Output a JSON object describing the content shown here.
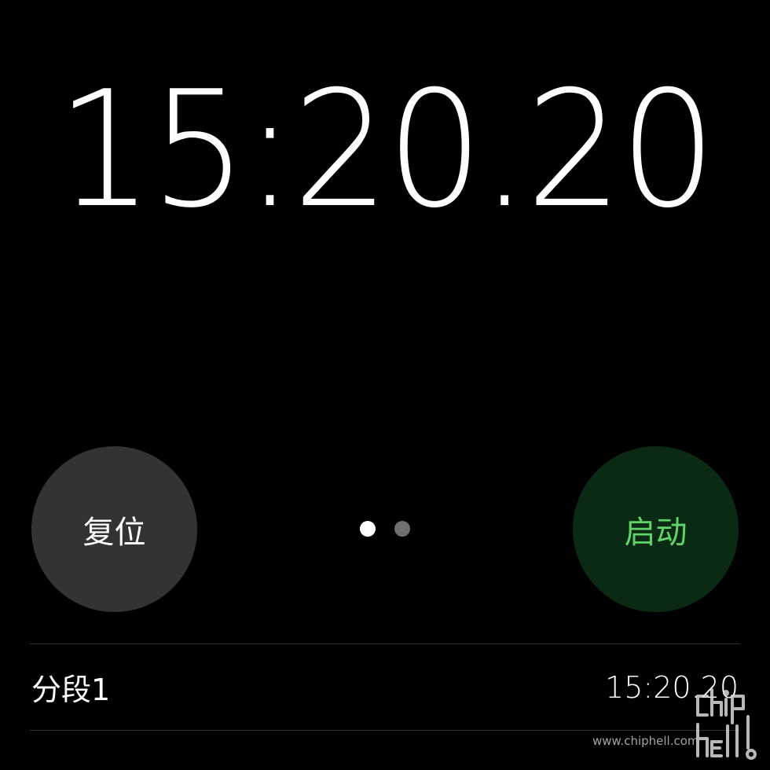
{
  "stopwatch": {
    "time": "15:20.20"
  },
  "buttons": {
    "reset_label": "复位",
    "start_label": "启动"
  },
  "pager": {
    "current_page": 1,
    "total_pages": 2
  },
  "laps": [
    {
      "label": "分段1",
      "time": "15:20.20"
    }
  ],
  "watermark": {
    "url": "www.chiphell.com",
    "logo_text": "chiphell"
  },
  "colors": {
    "background": "#000000",
    "reset_button_bg": "#333333",
    "start_button_bg": "#0b2a13",
    "start_button_text": "#62d26a",
    "divider": "#2e2e2e"
  }
}
